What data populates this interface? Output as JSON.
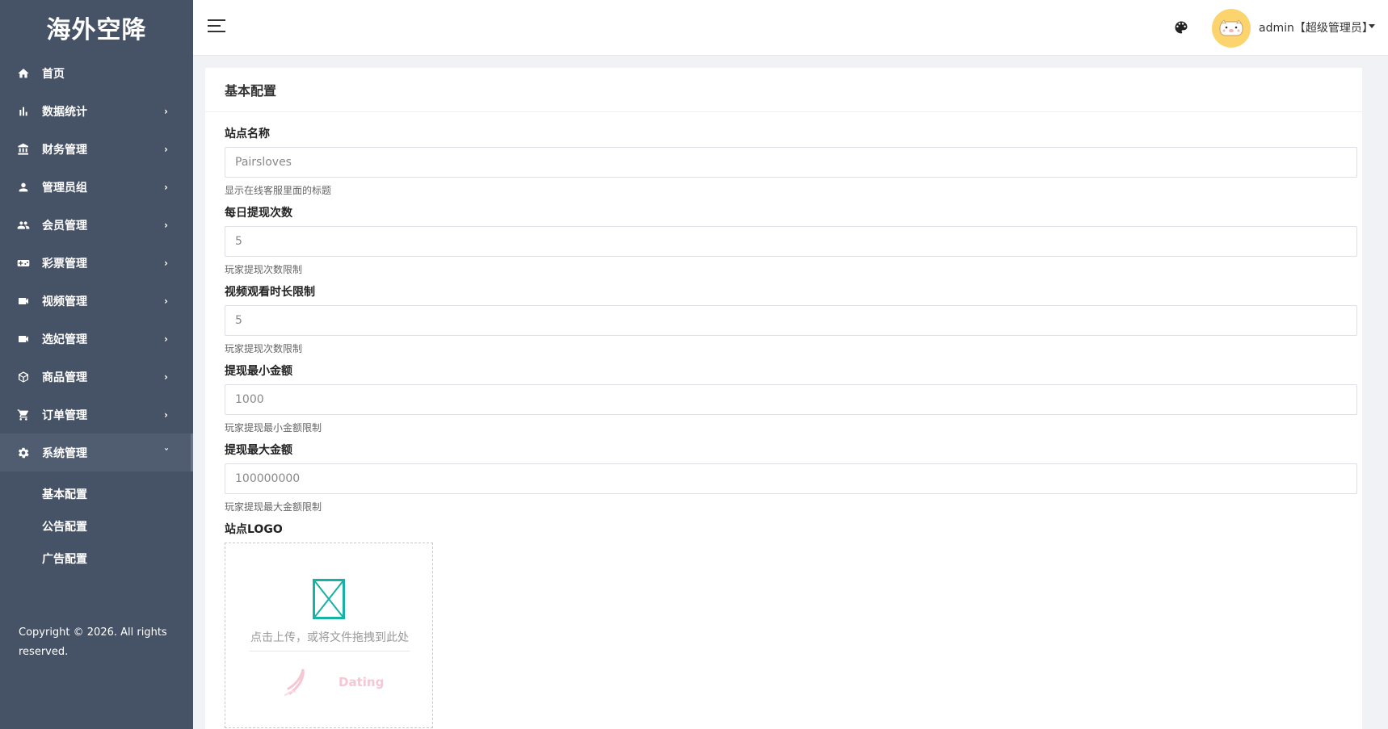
{
  "brand": "海外空降",
  "sidebar": {
    "items": [
      {
        "label": "首页",
        "icon": "home-icon",
        "has_chevron": false
      },
      {
        "label": "数据统计",
        "icon": "bar-chart-icon",
        "has_chevron": true
      },
      {
        "label": "财务管理",
        "icon": "bank-icon",
        "has_chevron": true
      },
      {
        "label": "管理员组",
        "icon": "person-icon",
        "has_chevron": true
      },
      {
        "label": "会员管理",
        "icon": "people-icon",
        "has_chevron": true
      },
      {
        "label": "彩票管理",
        "icon": "gamepad-icon",
        "has_chevron": true
      },
      {
        "label": "视频管理",
        "icon": "video-camera-icon",
        "has_chevron": true
      },
      {
        "label": "选妃管理",
        "icon": "video-camera-icon",
        "has_chevron": true
      },
      {
        "label": "商品管理",
        "icon": "cube-icon",
        "has_chevron": true
      },
      {
        "label": "订单管理",
        "icon": "cart-icon",
        "has_chevron": true
      },
      {
        "label": "系统管理",
        "icon": "gear-icon",
        "has_chevron": true,
        "active": true
      }
    ],
    "submenu": [
      "基本配置",
      "公告配置",
      "广告配置"
    ],
    "copyright": "Copyright © 2026. All rights reserved."
  },
  "header": {
    "user": "admin【超级管理员】",
    "icons": [
      "hamburger-menu-icon",
      "palette-icon",
      "pig-avatar-icon",
      "caret-down-icon"
    ]
  },
  "card": {
    "title": "基本配置",
    "fields": [
      {
        "label": "站点名称",
        "value": "Pairsloves",
        "hint": "显示在线客服里面的标题"
      },
      {
        "label": "每日提现次数",
        "value": "5",
        "hint": "玩家提现次数限制"
      },
      {
        "label": "视频观看时长限制",
        "value": "5",
        "hint": "玩家提现次数限制"
      },
      {
        "label": "提现最小金额",
        "value": "1000",
        "hint": "玩家提现最小金额限制"
      },
      {
        "label": "提现最大金额",
        "value": "100000000",
        "hint": "玩家提现最大金额限制"
      }
    ],
    "logo": {
      "label": "站点LOGO",
      "upload_text": "点击上传，或将文件拖拽到此处",
      "preview_text": "Dating"
    }
  },
  "colors": {
    "sidebar_bg": "#465265",
    "active_item_bg": "#505d71",
    "avatar_bg": "#fcd46e",
    "upload_icon": "#16b2a5",
    "logo_pink": "#f6c6d3"
  }
}
